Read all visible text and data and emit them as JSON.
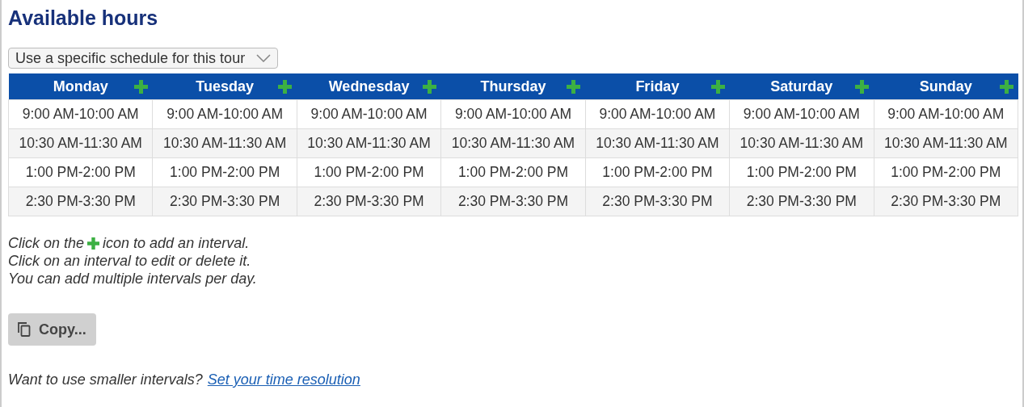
{
  "title": "Available hours",
  "schedule_select": {
    "value": "Use a specific schedule for this tour"
  },
  "days": [
    {
      "name": "Monday",
      "intervals": [
        "9:00 AM-10:00 AM",
        "10:30 AM-11:30 AM",
        "1:00 PM-2:00 PM",
        "2:30 PM-3:30 PM"
      ]
    },
    {
      "name": "Tuesday",
      "intervals": [
        "9:00 AM-10:00 AM",
        "10:30 AM-11:30 AM",
        "1:00 PM-2:00 PM",
        "2:30 PM-3:30 PM"
      ]
    },
    {
      "name": "Wednesday",
      "intervals": [
        "9:00 AM-10:00 AM",
        "10:30 AM-11:30 AM",
        "1:00 PM-2:00 PM",
        "2:30 PM-3:30 PM"
      ]
    },
    {
      "name": "Thursday",
      "intervals": [
        "9:00 AM-10:00 AM",
        "10:30 AM-11:30 AM",
        "1:00 PM-2:00 PM",
        "2:30 PM-3:30 PM"
      ]
    },
    {
      "name": "Friday",
      "intervals": [
        "9:00 AM-10:00 AM",
        "10:30 AM-11:30 AM",
        "1:00 PM-2:00 PM",
        "2:30 PM-3:30 PM"
      ]
    },
    {
      "name": "Saturday",
      "intervals": [
        "9:00 AM-10:00 AM",
        "10:30 AM-11:30 AM",
        "1:00 PM-2:00 PM",
        "2:30 PM-3:30 PM"
      ]
    },
    {
      "name": "Sunday",
      "intervals": [
        "9:00 AM-10:00 AM",
        "10:30 AM-11:30 AM",
        "1:00 PM-2:00 PM",
        "2:30 PM-3:30 PM"
      ]
    }
  ],
  "instructions": {
    "line_1_before_icon": "Click on the",
    "line_1_after_icon": "icon to add an interval.",
    "lines": [
      "Click on an interval to edit or delete it.",
      "You can add multiple intervals per day."
    ]
  },
  "copy_button": {
    "label": "Copy..."
  },
  "footer": {
    "text": "Want to use smaller intervals?",
    "link": "Set your time resolution"
  }
}
